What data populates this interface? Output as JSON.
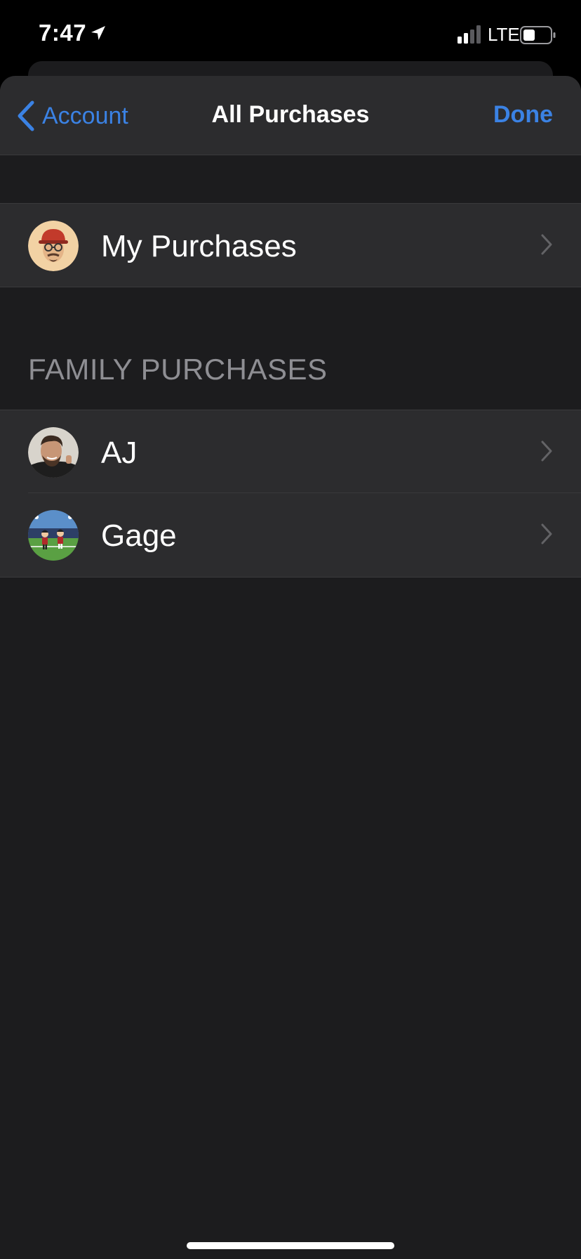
{
  "status_bar": {
    "time": "7:47",
    "network": "LTE",
    "icons": [
      "location-arrow-icon",
      "cellular-signal-icon",
      "battery-icon"
    ]
  },
  "nav": {
    "back_label": "Account",
    "title": "All Purchases",
    "done_label": "Done"
  },
  "my_purchases": {
    "label": "My Purchases",
    "avatar": "memoji-avatar"
  },
  "family_section": {
    "header": "FAMILY PURCHASES",
    "members": [
      {
        "label": "AJ",
        "avatar": "photo-avatar"
      },
      {
        "label": "Gage",
        "avatar": "cartoon-avatar"
      }
    ]
  },
  "colors": {
    "accent": "#3b82e4",
    "background": "#1c1c1e",
    "cell": "#2c2c2e",
    "secondary_text": "#8e8e93"
  }
}
